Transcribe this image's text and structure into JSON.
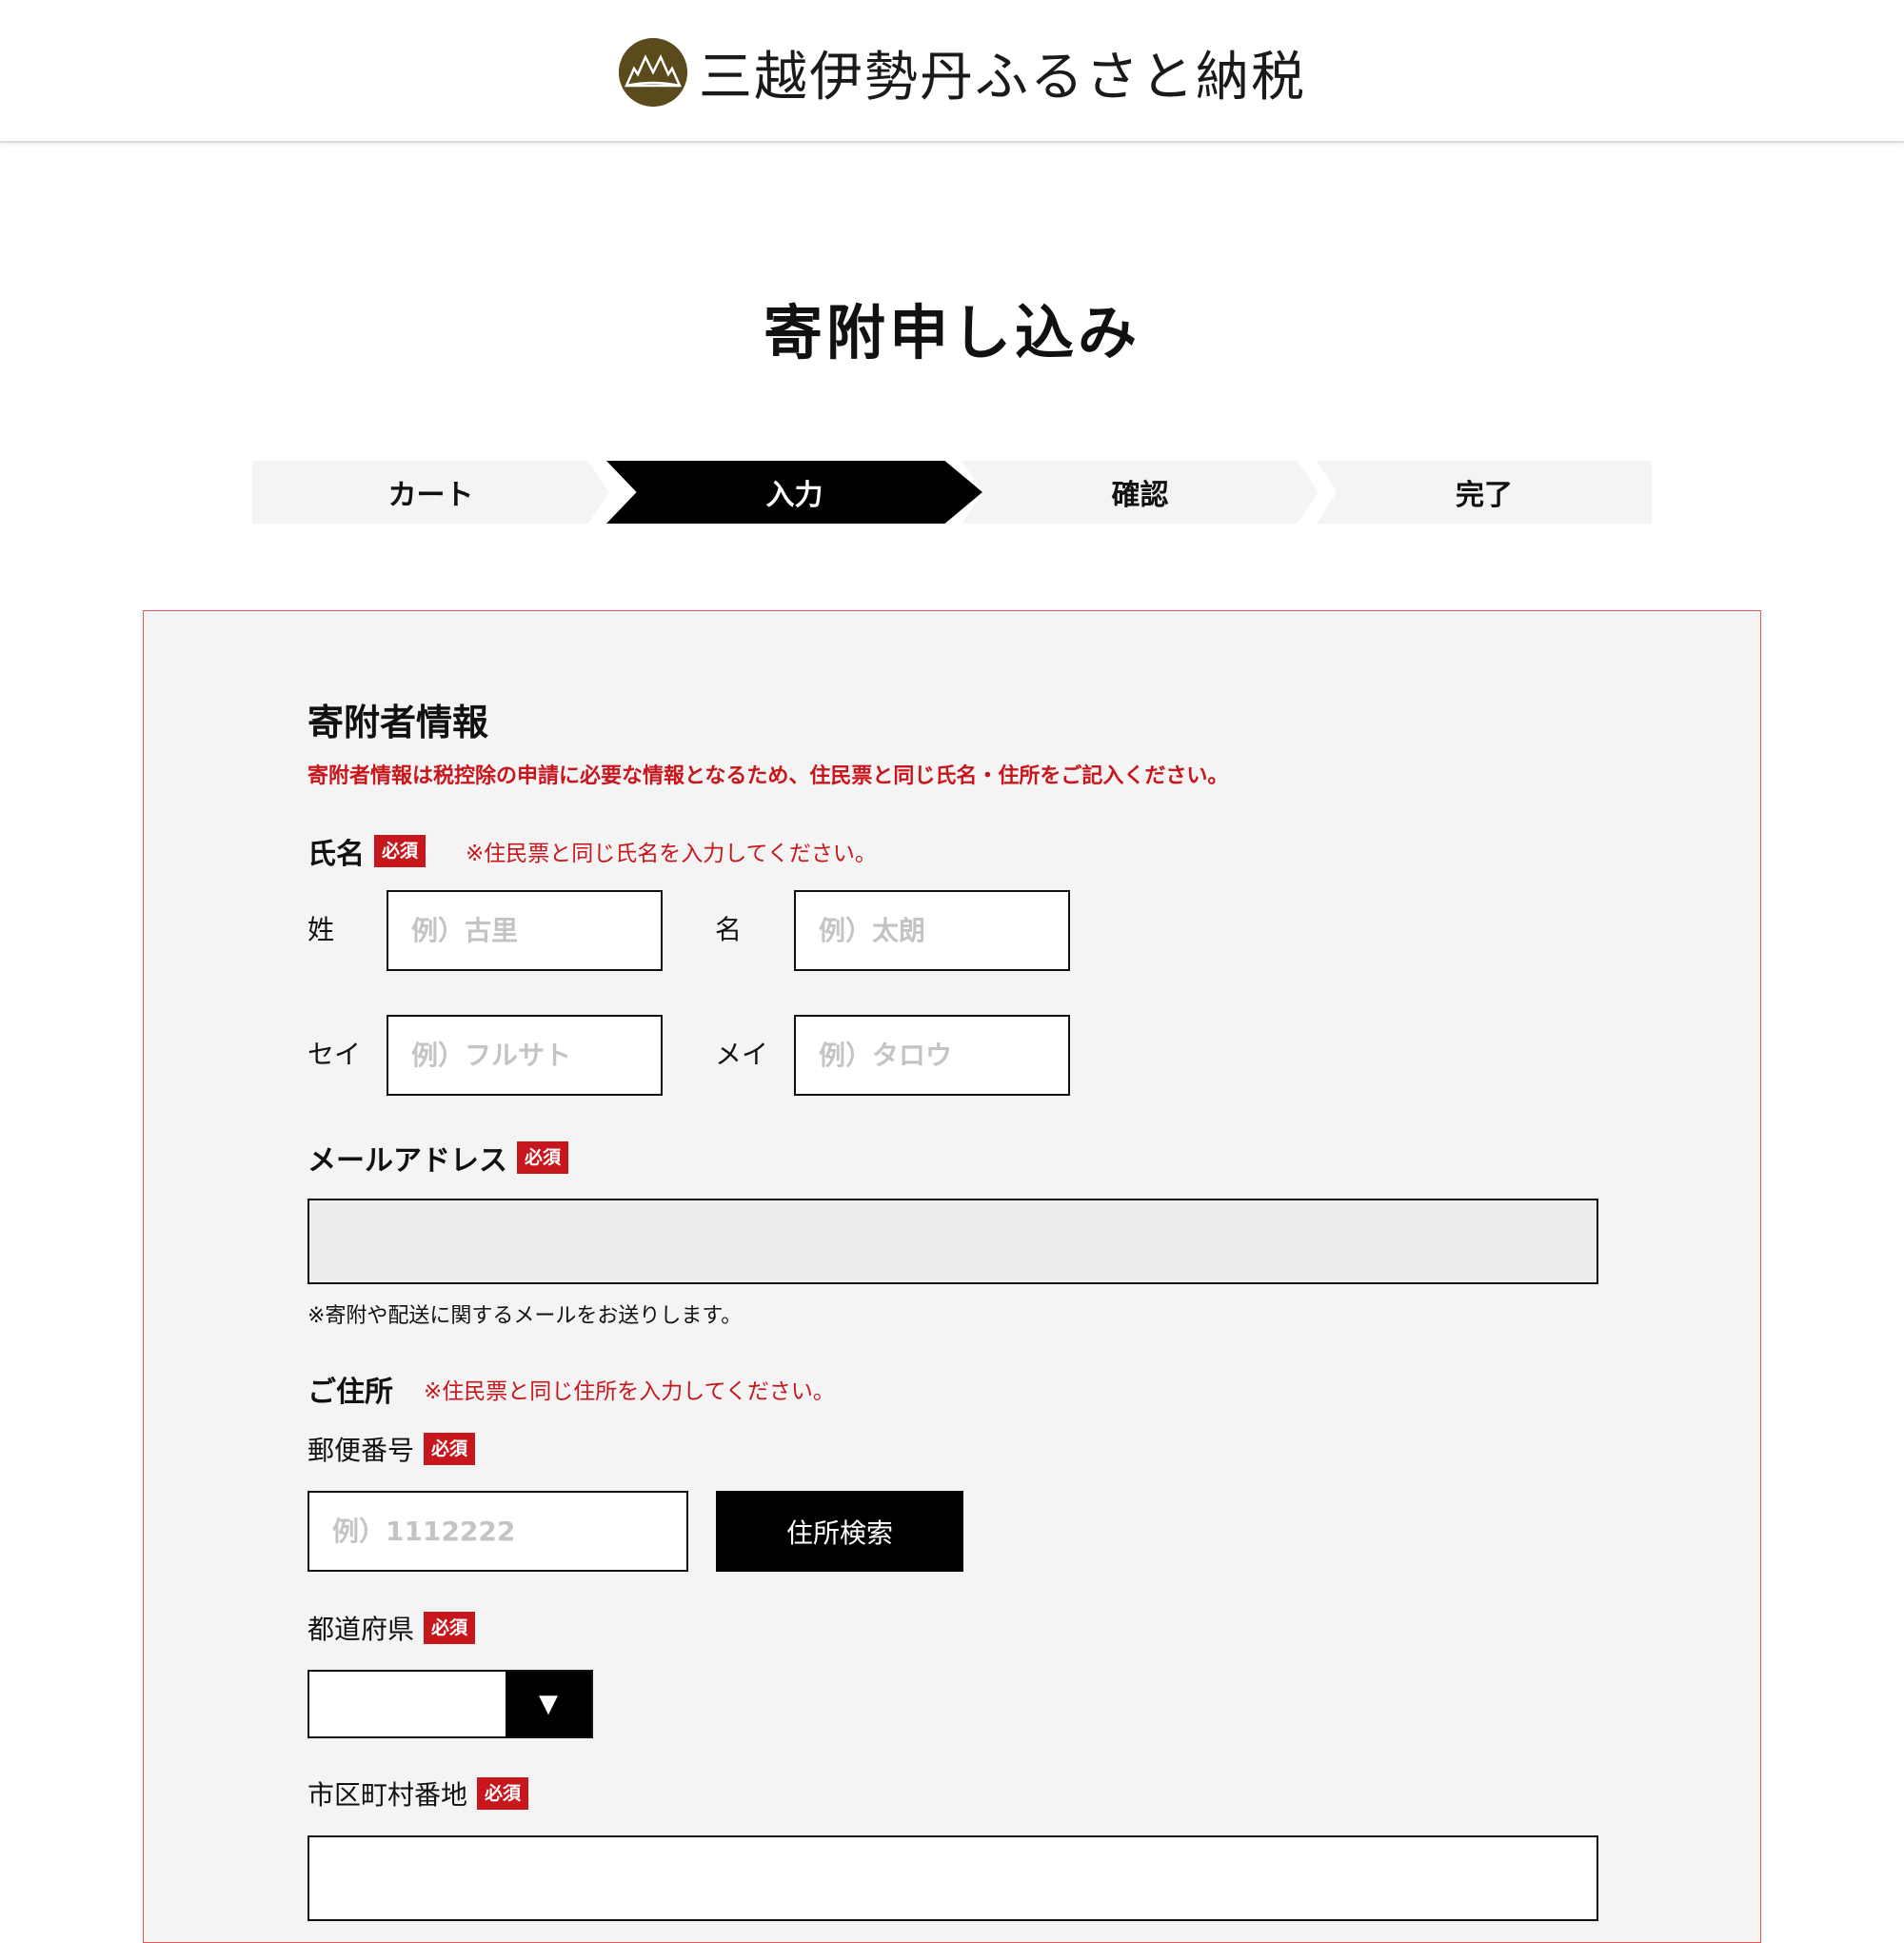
{
  "header": {
    "brand_name": "三越伊勢丹ふるさと納税",
    "logo_icon": "mountain-emblem-icon",
    "brand_color": "#5a4a1c"
  },
  "page": {
    "title": "寄附申し込み"
  },
  "steps": [
    {
      "label": "カート",
      "state": "done"
    },
    {
      "label": "入力",
      "state": "active"
    },
    {
      "label": "確認",
      "state": "pending"
    },
    {
      "label": "完了",
      "state": "pending"
    }
  ],
  "form": {
    "section_title": "寄附者情報",
    "section_notice": "寄附者情報は税控除の申請に必要な情報となるため、住民票と同じ氏名・住所をご記入ください。",
    "required_badge": "必須",
    "name": {
      "label": "氏名",
      "note": "※住民票と同じ氏名を入力してください。",
      "last_label": "姓",
      "last_placeholder": "例）古里",
      "first_label": "名",
      "first_placeholder": "例）太朗",
      "last_kana_label": "セイ",
      "last_kana_placeholder": "例）フルサト",
      "first_kana_label": "メイ",
      "first_kana_placeholder": "例）タロウ"
    },
    "email": {
      "label": "メールアドレス",
      "value": "",
      "note": "※寄附や配送に関するメールをお送りします。"
    },
    "address": {
      "label": "ご住所",
      "note": "※住民票と同じ住所を入力してください。",
      "postal_label": "郵便番号",
      "postal_placeholder": "例）1112222",
      "search_button": "住所検索",
      "prefecture_label": "都道府県",
      "prefecture_value": "",
      "prefecture_arrow": "▼",
      "city_label": "市区町村番地"
    },
    "accent_color": "#c8161d"
  }
}
